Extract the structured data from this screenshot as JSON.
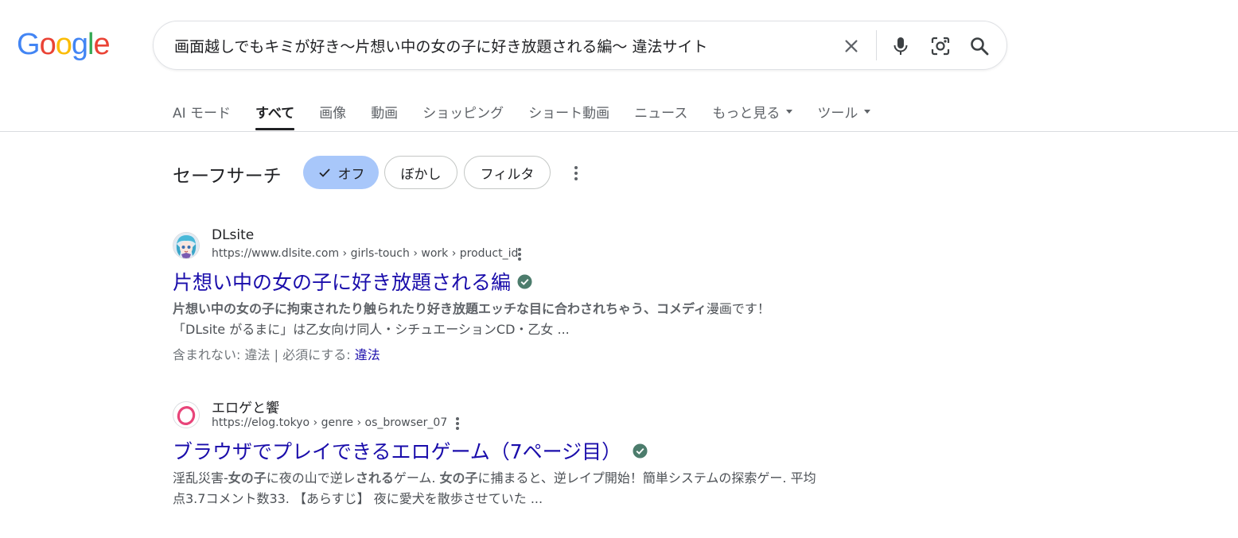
{
  "logo": {
    "text": "Google",
    "colors": [
      "#4285F4",
      "#EA4335",
      "#FBBC05",
      "#4285F4",
      "#34A853",
      "#EA4335"
    ]
  },
  "search": {
    "query": "画面越しでもキミが好き〜片想い中の女の子に好き放題される編〜 違法サイト"
  },
  "tabs": [
    {
      "label": "AI モード",
      "active": false,
      "dropdown": false
    },
    {
      "label": "すべて",
      "active": true,
      "dropdown": false
    },
    {
      "label": "画像",
      "active": false,
      "dropdown": false
    },
    {
      "label": "動画",
      "active": false,
      "dropdown": false
    },
    {
      "label": "ショッピング",
      "active": false,
      "dropdown": false
    },
    {
      "label": "ショート動画",
      "active": false,
      "dropdown": false
    },
    {
      "label": "ニュース",
      "active": false,
      "dropdown": false
    },
    {
      "label": "もっと見る",
      "active": false,
      "dropdown": true
    },
    {
      "label": "ツール",
      "active": false,
      "dropdown": true
    }
  ],
  "safesearch": {
    "label": "セーフサーチ",
    "options": [
      {
        "label": "オフ",
        "selected": true
      },
      {
        "label": "ぼかし",
        "selected": false
      },
      {
        "label": "フィルタ",
        "selected": false
      }
    ]
  },
  "results": [
    {
      "site_name": "DLsite",
      "url": "https://www.dlsite.com › girls-touch › work › product_id",
      "title": "片想い中の女の子に好き放題される編",
      "verified": true,
      "snippet_bold": "片想い中の女の子に拘束されたり触られたり好き放題エッチな目に合わされちゃう、コメディ",
      "snippet_rest": "漫画です！「DLsite がるまに」は乙女向け同人・シチュエーションCD・乙女 ...",
      "missing_label": "含まれない:",
      "missing_term": "違法",
      "separator": "|",
      "must_include_label": "必須にする:",
      "must_include_term": "違法"
    },
    {
      "site_name": "エロゲと饗",
      "url": "https://elog.tokyo › genre › os_browser_07",
      "title": "ブラウザでプレイできるエロゲーム（7ページ目）",
      "verified": true,
      "snippet_parts": [
        {
          "text": "淫乱災害-",
          "bold": false
        },
        {
          "text": "女の子",
          "bold": true
        },
        {
          "text": "に夜の山で逆レ",
          "bold": false
        },
        {
          "text": "される",
          "bold": true
        },
        {
          "text": "ゲーム. ",
          "bold": false
        },
        {
          "text": "女の子",
          "bold": true
        },
        {
          "text": "に捕まると、逆レイプ開始！簡単システムの探索ゲー. 平均点3.7コメント数33. 【あらすじ】 夜に愛犬を散歩させていた ...",
          "bold": false
        }
      ]
    }
  ],
  "colors": {
    "link": "#1a0dab",
    "verified": "#4c7c6c",
    "chip_selected": "#a8c7fa"
  }
}
